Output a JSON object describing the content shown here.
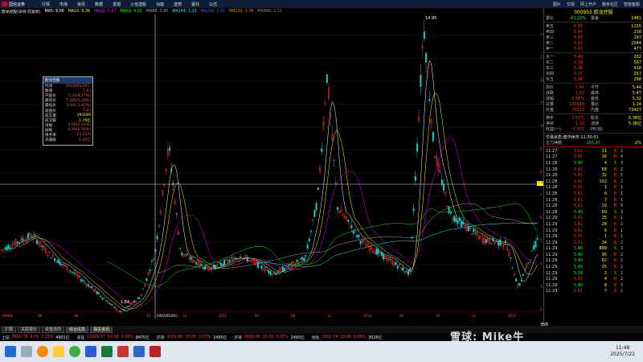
{
  "menubar": {
    "brand": "国信证券",
    "items": [
      "行情",
      "市场",
      "资讯",
      "数据",
      "发现",
      "小信选股",
      "功能",
      "选势",
      "委托",
      "公式"
    ],
    "right": [
      "图片",
      "交易",
      "网上开户",
      "服务社区",
      "智能客服"
    ]
  },
  "chart_header": {
    "title": "欧龙控股(日线 前复权)",
    "mas": [
      {
        "label": "MA5: 6.06",
        "color": "#ffffff"
      },
      {
        "label": "MA10: 6.36",
        "color": "#ffff00"
      },
      {
        "label": "MA20: 5.97",
        "color": "#ff00ff"
      },
      {
        "label": "MA60: 4.65",
        "color": "#00ff00"
      },
      {
        "label": "MA88: 3.95",
        "color": "#aaaaaa"
      },
      {
        "label": "MA144: 3.23",
        "color": "#00ffff"
      },
      {
        "label": "MA200: 2.91",
        "color": "#5555ff"
      },
      {
        "label": "MA233: 2.76",
        "color": "#ff8800"
      },
      {
        "label": "MA888: 2.13",
        "color": "#888888"
      }
    ]
  },
  "price_axis": [
    "14.00",
    "13.00",
    "12.00",
    "11.00",
    "10.00",
    "9.00",
    "8.00",
    "7.00",
    "6.00",
    "5.00",
    "4.00",
    "3.00",
    "2.00"
  ],
  "price_marker": "7.10",
  "peak_label": "14.95",
  "low_label": "1.84",
  "date_axis": [
    "1999年",
    "08",
    "08",
    "2007/05/29二",
    "10",
    "12",
    "2011",
    "04",
    "08",
    "12",
    "2014",
    "06",
    "10",
    "12",
    "2017"
  ],
  "infobox": {
    "title": "欧龙控股",
    "rows": [
      {
        "label": "时间",
        "value": "2007/05/29二"
      },
      {
        "label": "数值",
        "value": "7.10"
      },
      {
        "label": "开盘价",
        "value": "7.31(4.17%)"
      },
      {
        "label": "最高价",
        "value": "7.385(5.28%)"
      },
      {
        "label": "最低价",
        "value": "6.92(-1.42%)"
      },
      {
        "label": "收盘价",
        "value": "7.10"
      },
      {
        "label": "成交量",
        "value": "193189"
      },
      {
        "label": "成交额",
        "value": "1.79亿"
      },
      {
        "label": "涨幅",
        "value": "0.00(0.14%)"
      },
      {
        "label": "振幅",
        "value": "0.46(6.55%)"
      },
      {
        "label": "换手率",
        "value": "13.31%"
      },
      {
        "label": "流通股",
        "value": "1.45亿"
      }
    ]
  },
  "right_panel": {
    "code_name": "000955 欧龙控股",
    "weibi": {
      "label": "委比",
      "value": "-43.22%",
      "diff_label": "委差",
      "diff": "2481"
    },
    "sells": [
      {
        "label": "卖五",
        "price": "5.45",
        "vol": "1155"
      },
      {
        "label": "卖四",
        "price": "5.44",
        "vol": "238"
      },
      {
        "label": "卖三",
        "price": "5.43",
        "vol": "197"
      },
      {
        "label": "卖二",
        "price": "5.42",
        "vol": "2044"
      },
      {
        "label": "卖一",
        "price": "5.41",
        "vol": "477"
      }
    ],
    "buys": [
      {
        "label": "买一",
        "price": "5.40",
        "vol": "202"
      },
      {
        "label": "买二",
        "price": "5.39",
        "vol": "567"
      },
      {
        "label": "买三",
        "price": "5.38",
        "vol": "418"
      },
      {
        "label": "买四",
        "price": "5.37",
        "vol": "257"
      },
      {
        "label": "买五",
        "price": "5.36",
        "vol": "298"
      }
    ],
    "quote": [
      {
        "l1": "现价",
        "v1": "5.41",
        "l2": "今开",
        "v2": "5.44"
      },
      {
        "l1": "涨跌",
        "v1": "0.03",
        "l2": "最高",
        "v2": "5.47"
      },
      {
        "l1": "涨幅",
        "v1": "0.56%",
        "l2": "最低",
        "v2": "5.32"
      },
      {
        "l1": "总量",
        "v1": "143640",
        "l2": "量比",
        "v2": "1.24"
      },
      {
        "l1": "外盘",
        "v1": "70213",
        "l2": "内盘",
        "v2": "73427"
      }
    ],
    "fund": [
      {
        "l1": "换手",
        "v1": "2.67%",
        "l2": "股本",
        "v2": "5.38亿"
      },
      {
        "l1": "净资",
        "v1": "1.20",
        "l2": "流通",
        "v2": "5.38亿"
      },
      {
        "l1": "收益(一)",
        "v1": "-0.002",
        "l2": "PE(动)",
        "v2": ""
      }
    ],
    "status": "交易状态:盘中休市 11:30:01",
    "netflow": {
      "label": "主力净额",
      "value": "-155.97",
      "pct": "-2%"
    },
    "ticks": [
      {
        "t": "11:27",
        "p": "5.41",
        "v": "11",
        "d": "B",
        "s": "1"
      },
      {
        "t": "11:27",
        "p": "5.41",
        "v": "16",
        "d": "B",
        "s": "4"
      },
      {
        "t": "11:28",
        "p": "5.40",
        "v": "4",
        "d": "S",
        "s": "3"
      },
      {
        "t": "11:28",
        "p": "5.41",
        "v": "68",
        "d": "B",
        "s": "2"
      },
      {
        "t": "11:28",
        "p": "5.41",
        "v": "32",
        "d": "B",
        "s": "1"
      },
      {
        "t": "11:28",
        "p": "5.41",
        "v": "102",
        "d": "B",
        "s": "2"
      },
      {
        "t": "11:28",
        "p": "5.41",
        "v": "1",
        "d": "B",
        "s": "1"
      },
      {
        "t": "11:28",
        "p": "5.41",
        "v": "6",
        "d": "B",
        "s": "1"
      },
      {
        "t": "11:28",
        "p": "5.41",
        "v": "7",
        "d": "B",
        "s": "1"
      },
      {
        "t": "11:28",
        "p": "5.41",
        "v": "10",
        "d": "B",
        "s": "5"
      },
      {
        "t": "11:28",
        "p": "5.40",
        "v": "69",
        "d": "S",
        "s": "3"
      },
      {
        "t": "11:29",
        "p": "5.41",
        "v": "25",
        "d": "B",
        "s": "1"
      },
      {
        "t": "11:29",
        "p": "5.41",
        "v": "28",
        "d": "B",
        "s": "2"
      },
      {
        "t": "11:29",
        "p": "5.41",
        "v": "6",
        "d": "B",
        "s": "1"
      },
      {
        "t": "11:29",
        "p": "5.41",
        "v": "1",
        "d": "B",
        "s": "1"
      },
      {
        "t": "11:29",
        "p": "5.41",
        "v": "34",
        "d": "B",
        "s": "2"
      },
      {
        "t": "11:29",
        "p": "5.40",
        "v": "888",
        "d": "S",
        "s": "3"
      },
      {
        "t": "11:29",
        "p": "5.40",
        "v": "95",
        "d": "B",
        "s": "2"
      },
      {
        "t": "11:29",
        "p": "5.40",
        "v": "62",
        "d": "B",
        "s": "1"
      },
      {
        "t": "11:29",
        "p": "5.40",
        "v": "35",
        "d": "B",
        "s": "2"
      },
      {
        "t": "11:29",
        "p": "5.39",
        "v": "2",
        "d": "S",
        "s": "1"
      },
      {
        "t": "11:29",
        "p": "5.41",
        "v": "4",
        "d": "B",
        "s": "2"
      },
      {
        "t": "11:29",
        "p": "5.40",
        "v": "8",
        "d": "B",
        "s": "3"
      },
      {
        "t": "11:29",
        "p": "5.41",
        "v": "7",
        "d": "B",
        "s": "1"
      }
    ],
    "period_label": "日线"
  },
  "bottom_tabs": [
    "扩展",
    "关联报价",
    "资金流向",
    "综合信息",
    "相关资讯"
  ],
  "index_bar": [
    {
      "name": "上证",
      "val": "3560.78",
      "chg": "8.59",
      "pct": "0.25%",
      "amt": "4901亿"
    },
    {
      "name": "深证",
      "val": "11069.57",
      "chg": "62.08",
      "pct": "0.56%",
      "amt": "8470亿"
    },
    {
      "name": "沪深",
      "val": "4100.66",
      "chg": "15.05",
      "pct": "0.37%",
      "amt": "2495亿"
    },
    {
      "name": "沪深",
      "val": "4100.66",
      "chg": "15.05",
      "pct": "0.37%",
      "amt": "2495亿"
    },
    {
      "name": "创业",
      "val": "2312.74",
      "chg": "15.86",
      "pct": "0.69%",
      "amt": "3026亿"
    }
  ],
  "taskbar": {
    "time": "11:48",
    "date": "2025/7/22"
  },
  "watermark": "雪球: Mike牛"
}
